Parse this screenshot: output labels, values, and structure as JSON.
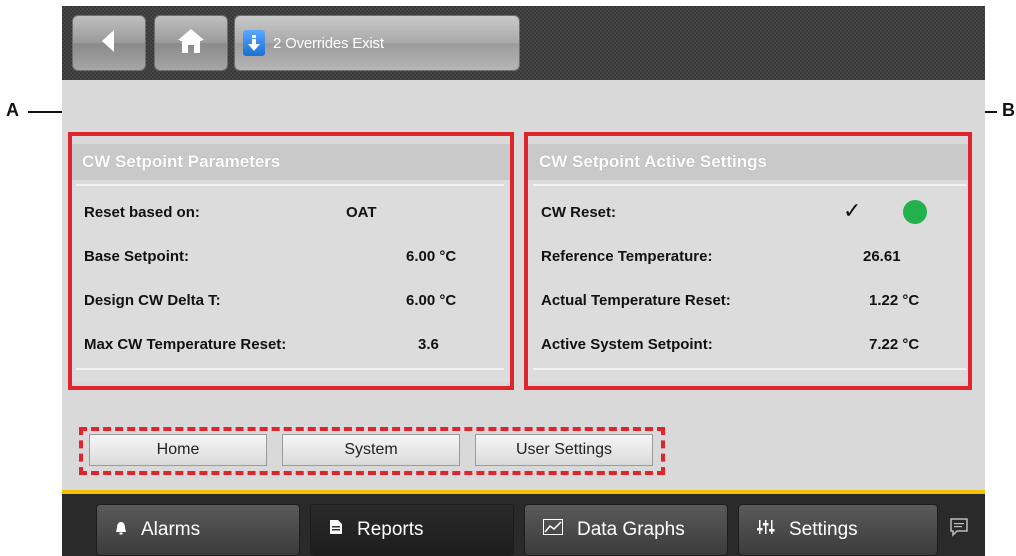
{
  "topbar": {
    "back_icon": "back-arrow-icon",
    "home_icon": "home-icon",
    "override_icon": "download-arrow-icon",
    "override_label": "2 Overrides Exist"
  },
  "left_panel": {
    "title": "CW Setpoint Parameters",
    "rows": [
      {
        "label": "Reset based on:",
        "value": "OAT"
      },
      {
        "label": "Base Setpoint:",
        "value": "6.00 °C"
      },
      {
        "label": "Design CW Delta T:",
        "value": "6.00 °C"
      },
      {
        "label": "Max CW Temperature Reset:",
        "value": "3.6"
      }
    ]
  },
  "right_panel": {
    "title": "CW Setpoint Active Settings",
    "rows": [
      {
        "label": "CW Reset:",
        "value": "✓",
        "status_color": "#22b14c"
      },
      {
        "label": "Reference Temperature:",
        "value": "26.61"
      },
      {
        "label": "Actual Temperature Reset:",
        "value": "1.22 °C"
      },
      {
        "label": "Active System Setpoint:",
        "value": "7.22 °C"
      }
    ]
  },
  "nav_buttons": {
    "home": "Home",
    "system": "System",
    "user_settings": "User Settings"
  },
  "tabs": {
    "alarms": "Alarms",
    "reports": "Reports",
    "data_graphs": "Data Graphs",
    "settings": "Settings"
  },
  "callouts": {
    "a": "A",
    "b": "B"
  },
  "colors": {
    "annotation_red": "#e0242b",
    "tab_accent": "#f2c200"
  }
}
